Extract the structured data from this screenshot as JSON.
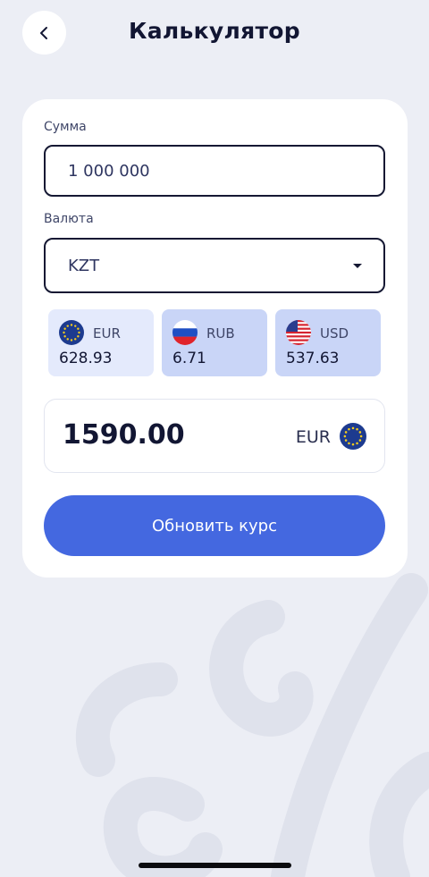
{
  "header": {
    "title": "Калькулятор",
    "back_icon": "chevron-left-icon"
  },
  "form": {
    "amount_label": "Сумма",
    "amount_value": "1 000 000",
    "currency_label": "Валюта",
    "currency_value": "KZT",
    "currency_icon": "caret-down-icon"
  },
  "rates": [
    {
      "code": "EUR",
      "rate": "628.93",
      "flag": "eu-flag-icon",
      "selected": true
    },
    {
      "code": "RUB",
      "rate": "6.71",
      "flag": "ru-flag-icon",
      "selected": false
    },
    {
      "code": "USD",
      "rate": "537.63",
      "flag": "us-flag-icon",
      "selected": false
    }
  ],
  "result": {
    "value": "1590.00",
    "code": "EUR",
    "flag": "eu-flag-icon"
  },
  "actions": {
    "update_label": "Обновить курс"
  },
  "colors": {
    "background": "#eceef5",
    "card": "#ffffff",
    "accent": "#4468e0",
    "tile_selected": "#e4eafc",
    "tile_unselected": "#c9d5f7",
    "text_primary": "#121633"
  }
}
